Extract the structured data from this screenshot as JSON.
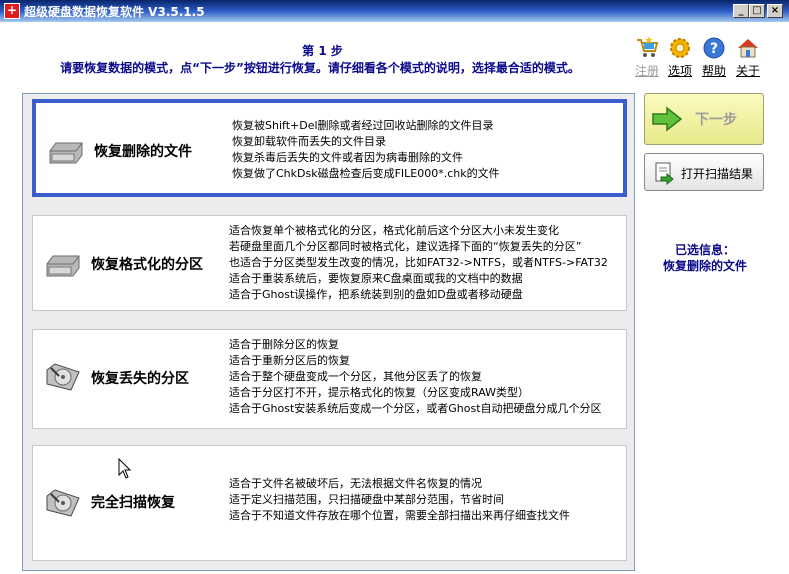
{
  "window": {
    "title": "超级硬盘数据恢复软件 V3.5.1.5",
    "app_icon_glyph": "+",
    "min_glyph": "_",
    "max_glyph": "□",
    "close_glyph": "×"
  },
  "header": {
    "step_title": "第 1 步",
    "instruction": "请要恢复数据的模式，点“下一步”按钮进行恢复。请仔细看各个模式的说明，选择最合适的模式。"
  },
  "toplinks": [
    {
      "label": "注册",
      "icon": "cart-icon",
      "disabled": true
    },
    {
      "label": "选项",
      "icon": "gear-icon",
      "disabled": false
    },
    {
      "label": "帮助",
      "icon": "help-icon",
      "disabled": false
    },
    {
      "label": "关于",
      "icon": "home-icon",
      "disabled": false
    }
  ],
  "options": [
    {
      "name": "恢复删除的文件",
      "selected": true,
      "lines": [
        "恢复被Shift+Del删除或者经过回收站删除的文件目录",
        "恢复卸载软件而丢失的文件目录",
        "恢复杀毒后丢失的文件或者因为病毒删除的文件",
        "恢复做了ChkDsk磁盘检查后变成FILE000*.chk的文件"
      ]
    },
    {
      "name": "恢复格式化的分区",
      "selected": false,
      "lines": [
        "适合恢复单个被格式化的分区，格式化前后这个分区大小未发生变化",
        "若硬盘里面几个分区都同时被格式化，建议选择下面的“恢复丢失的分区”",
        "也适合于分区类型发生改变的情况，比如FAT32->NTFS，或者NTFS->FAT32",
        "适合于重装系统后，要恢复原来C盘桌面或我的文档中的数据",
        "适合于Ghost误操作，把系统装到别的盘如D盘或者移动硬盘"
      ]
    },
    {
      "name": "恢复丢失的分区",
      "selected": false,
      "lines": [
        "适合于删除分区的恢复",
        "适合于重新分区后的恢复",
        "适合于整个硬盘变成一个分区，其他分区丢了的恢复",
        "适合于分区打不开，提示格式化的恢复（分区变成RAW类型）",
        "适合于Ghost安装系统后变成一个分区，或者Ghost自动把硬盘分成几个分区"
      ]
    },
    {
      "name": "完全扫描恢复",
      "selected": false,
      "lines": [
        "适合于文件名被破坏后，无法根据文件名恢复的情况",
        "适于定义扫描范围，只扫描硬盘中某部分范围，节省时间",
        "适合于不知道文件存放在哪个位置，需要全部扫描出来再仔细查找文件"
      ]
    }
  ],
  "buttons": {
    "next_label": "下一步",
    "open_scan_label": "打开扫描结果"
  },
  "selected_info": {
    "heading": "已选信息：",
    "value": "恢复删除的文件"
  },
  "colors": {
    "selected_border": "#3a5fcd",
    "heading_text": "#0a0a8a",
    "titlebar": "#0a246a"
  }
}
